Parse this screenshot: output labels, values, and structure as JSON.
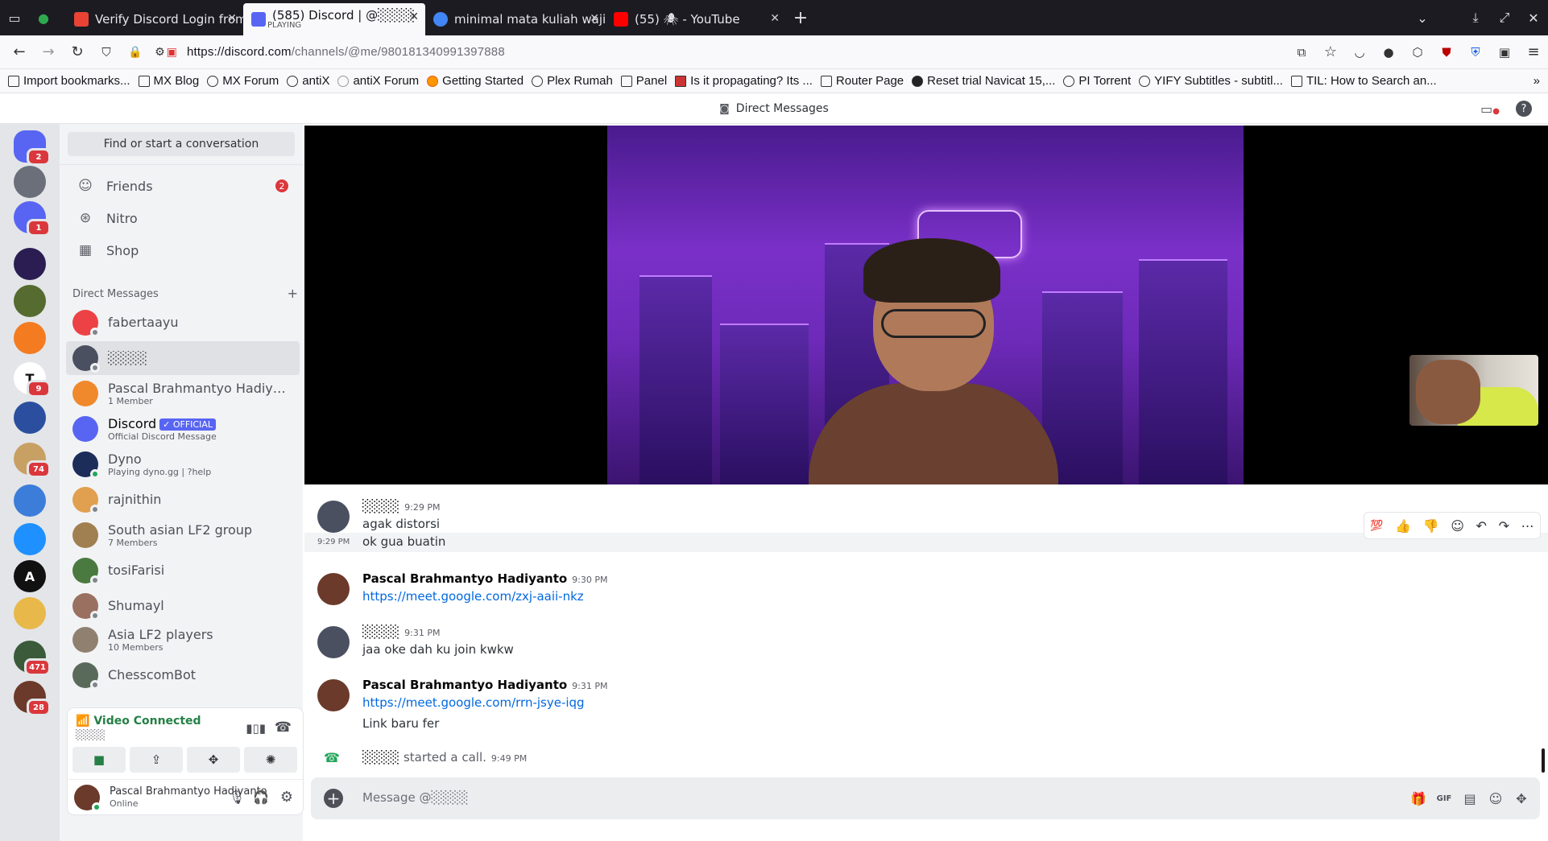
{
  "browser": {
    "tabs": [
      {
        "title": "Verify Discord Login from",
        "fav_color": "#ea4335"
      },
      {
        "title": "(585) Discord | @░░░░",
        "sub": "PLAYING",
        "fav_color": "#5865f2",
        "active": true
      },
      {
        "title": "minimal mata kuliah wajib",
        "fav_color": "#4285f4"
      },
      {
        "title": "(55) 🕷 - YouTube",
        "fav_color": "#ff0000"
      }
    ],
    "url_host": "https://discord.com",
    "url_path": "/channels/@me/980181340991397888",
    "bookmarks": [
      "Import bookmarks...",
      "MX Blog",
      "MX Forum",
      "antiX",
      "antiX Forum",
      "Getting Started",
      "Plex Rumah",
      "Panel",
      "Is it propagating? Its ...",
      "Router Page",
      "Reset trial Navicat 15,...",
      "PI Torrent",
      "YIFY Subtitles - subtitl...",
      "TIL: How to Search an..."
    ]
  },
  "discord": {
    "header_title": "Direct Messages",
    "guilds": [
      {
        "badge": "2",
        "color": "#5865f2"
      },
      {
        "badge": "",
        "color": "#6b6f7a"
      },
      {
        "badge": "1",
        "color": "#5865f2"
      },
      {
        "badge": "",
        "color": "#2b1d52"
      },
      {
        "badge": "",
        "color": "#556b2f"
      },
      {
        "badge": "",
        "color": "#f47b20"
      },
      {
        "badge": "9",
        "color": "#ffffff",
        "letter": "T"
      },
      {
        "badge": "",
        "color": "#2b4f9e"
      },
      {
        "badge": "74",
        "color": "#c8a064"
      },
      {
        "badge": "",
        "color": "#3c7dd9"
      },
      {
        "badge": "",
        "color": "#1e90ff"
      },
      {
        "badge": "",
        "color": "#111111",
        "letter": "A"
      },
      {
        "badge": "",
        "color": "#e8b84a"
      },
      {
        "badge": "471",
        "color": "#3a5a3a"
      },
      {
        "badge": "28",
        "color": "#6b3a2a"
      }
    ],
    "find_label": "Find or start a conversation",
    "nav": [
      {
        "label": "Friends",
        "badge": "2"
      },
      {
        "label": "Nitro",
        "badge": ""
      },
      {
        "label": "Shop",
        "badge": ""
      }
    ],
    "dm_header": "Direct Messages",
    "dms": [
      {
        "name": "fabertaayu",
        "sub": "",
        "color": "#ed4245"
      },
      {
        "name": "░░░░",
        "sub": "",
        "color": "#4a5060"
      },
      {
        "name": "Pascal Brahmantyo Hadiyanto'...",
        "sub": "1 Member",
        "color": "#f0892b"
      },
      {
        "name": "Discord",
        "sub": "Official Discord Message",
        "color": "#5865f2",
        "badge": "✓ OFFICIAL"
      },
      {
        "name": "Dyno",
        "sub": "Playing dyno.gg | ?help",
        "color": "#1d2d5a"
      },
      {
        "name": "rajnithin",
        "sub": "",
        "color": "#e0a050"
      },
      {
        "name": "South asian LF2 group",
        "sub": "7 Members",
        "color": "#a08050"
      },
      {
        "name": "tosiFarisi",
        "sub": "",
        "color": "#4a7a40"
      },
      {
        "name": "Shumayl",
        "sub": "",
        "color": "#9a7060"
      },
      {
        "name": "Asia LF2 players",
        "sub": "10 Members",
        "color": "#908070"
      },
      {
        "name": "ChesscomBot",
        "sub": "",
        "color": "#5a6a5a"
      }
    ],
    "voice": {
      "title": "Video Connected",
      "sub": "░░░░"
    },
    "user": {
      "name": "Pascal Brahmantyo Hadiyanto",
      "status": "Online"
    },
    "messages": [
      {
        "author": "░░░░",
        "time": "9:29 PM",
        "lines": [
          "agak distorsi"
        ]
      },
      {
        "side_time": "9:29 PM",
        "lines": [
          "ok gua buatin"
        ]
      },
      {
        "author": "Pascal Brahmantyo Hadiyanto",
        "time": "9:30 PM",
        "link": "https://meet.google.com/zxj-aaii-nkz"
      },
      {
        "author": "░░░░",
        "time": "9:31 PM",
        "lines": [
          "jaa oke dah ku join kwkw"
        ]
      },
      {
        "author": "Pascal Brahmantyo Hadiyanto",
        "time": "9:31 PM",
        "link": "https://meet.google.com/rrn-jsye-iqg",
        "lines": [
          "Link baru fer"
        ]
      }
    ],
    "call_event": {
      "who": "░░░░",
      "text": "started a call.",
      "time": "9:49 PM"
    },
    "hover_reactions": [
      "💯",
      "👍",
      "👎",
      "☺",
      "↶",
      "↷",
      "⋯"
    ],
    "composer_placeholder": "Message @░░░░",
    "accent": "#5865f2"
  }
}
